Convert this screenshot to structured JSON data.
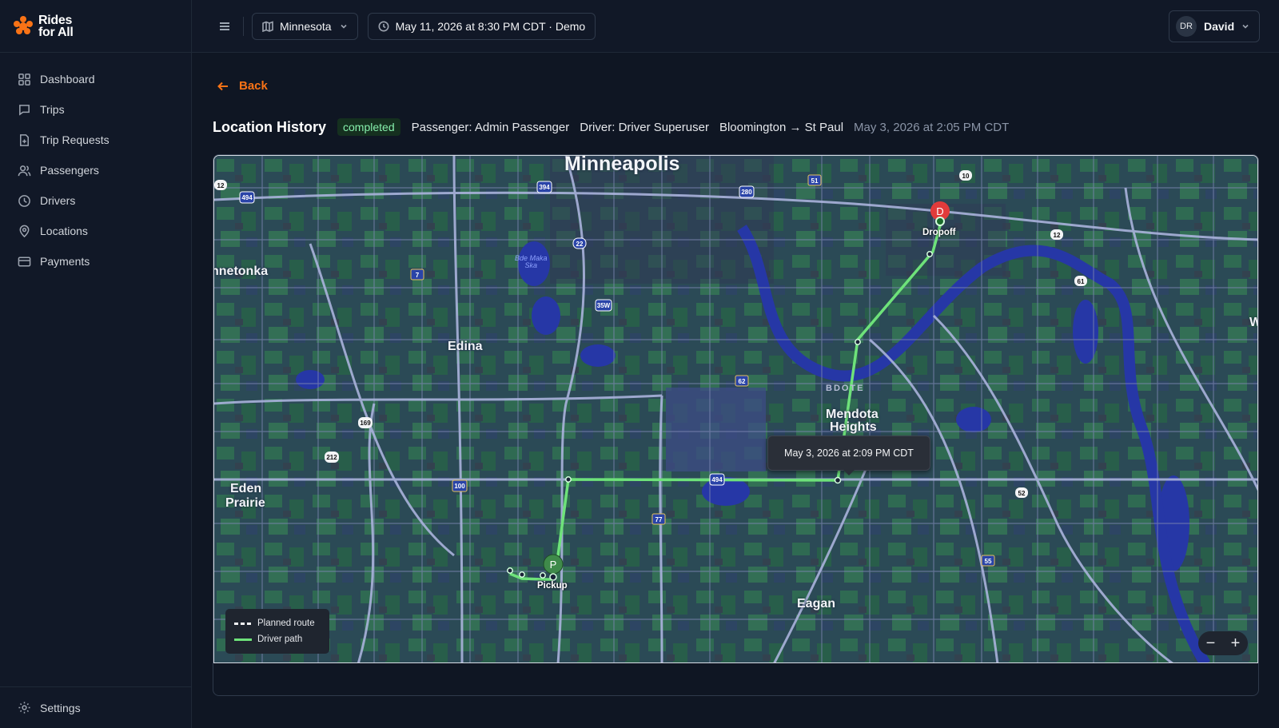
{
  "brand": {
    "name_line1": "Rides",
    "name_line2": "for All",
    "accent": "#f97316"
  },
  "sidebar": {
    "items": [
      {
        "label": "Dashboard",
        "icon": "grid-icon"
      },
      {
        "label": "Trips",
        "icon": "chat-icon"
      },
      {
        "label": "Trip Requests",
        "icon": "file-plus-icon"
      },
      {
        "label": "Passengers",
        "icon": "users-icon"
      },
      {
        "label": "Drivers",
        "icon": "clock-icon"
      },
      {
        "label": "Locations",
        "icon": "map-pin-icon"
      },
      {
        "label": "Payments",
        "icon": "credit-card-icon"
      }
    ],
    "settings_label": "Settings"
  },
  "header": {
    "region": "Minnesota",
    "datetime": "May 11, 2026 at 8:30 PM CDT · Demo",
    "user_initials": "DR",
    "user_name": "David"
  },
  "page": {
    "back_label": "Back",
    "title": "Location History",
    "status": "completed",
    "passenger": "Passenger: Admin Passenger",
    "driver": "Driver: Driver Superuser",
    "route": "Bloomington → St Paul",
    "date": "May 3, 2026 at 2:05 PM CDT"
  },
  "map": {
    "places": {
      "minneapolis": "Minneapolis",
      "minnetonka": "nnetonka",
      "edina": "Edina",
      "mendota1": "Mendota",
      "mendota2": "Heights",
      "eden1": "Eden",
      "eden2": "Prairie",
      "eagan": "Eagan",
      "bdote": "BDOTE",
      "lake1": "Bde Maka",
      "lake2": "Ska",
      "w": "W"
    },
    "highways": [
      "494",
      "394",
      "280",
      "51",
      "10",
      "12",
      "22",
      "7",
      "35W",
      "61",
      "62",
      "169",
      "212",
      "100",
      "77",
      "494",
      "52",
      "55",
      "12"
    ],
    "pickup_label": "Pickup",
    "pickup_letter": "P",
    "dropoff_label": "Dropoff",
    "dropoff_letter": "D",
    "tooltip": "May 3, 2026 at 2:09 PM CDT",
    "legend": {
      "planned": "Planned route",
      "driver": "Driver path"
    },
    "zoom_out": "−",
    "zoom_in": "+",
    "colors": {
      "driver_path": "#6ee27a",
      "dropoff": "#e23b3b",
      "pickup": "#3f8a4a"
    }
  }
}
